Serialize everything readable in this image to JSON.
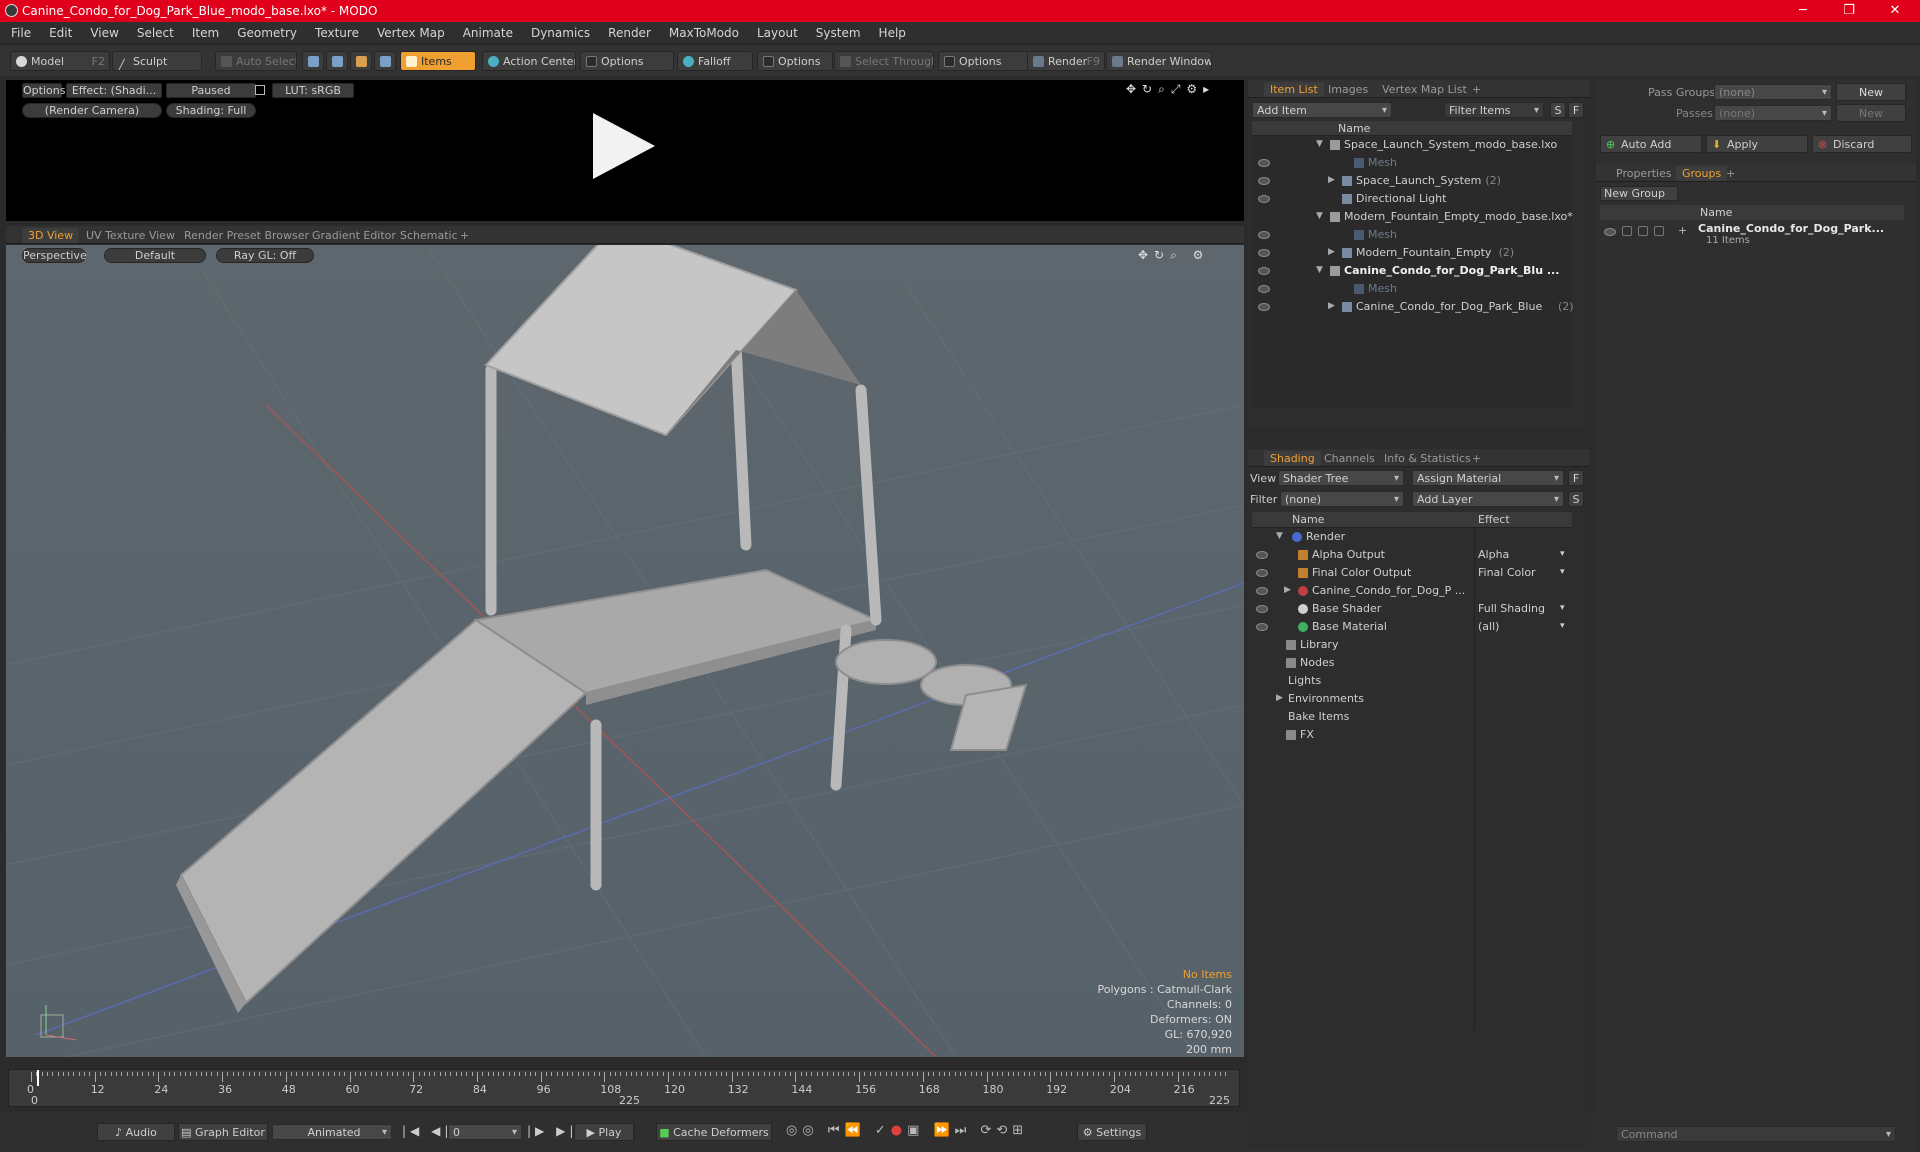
{
  "window": {
    "title": "Canine_Condo_for_Dog_Park_Blue_modo_base.lxo* - MODO",
    "min": "─",
    "max": "❐",
    "close": "✕"
  },
  "menu": [
    "File",
    "Edit",
    "View",
    "Select",
    "Item",
    "Geometry",
    "Texture",
    "Vertex Map",
    "Animate",
    "Dynamics",
    "Render",
    "MaxToModo",
    "Layout",
    "System",
    "Help"
  ],
  "toolbar": {
    "model": "Model",
    "model_key": "F2",
    "sculpt": "Sculpt",
    "auto_select": "Auto Select",
    "items": "Items",
    "action_center": "Action Center",
    "options1": "Options",
    "falloff": "Falloff",
    "options2": "Options",
    "select_through": "Select Through",
    "options3": "Options",
    "render": "Render",
    "render_key": "F9",
    "render_window": "Render Window"
  },
  "preview": {
    "options": "Options",
    "effect": "Effect: (Shadi...",
    "paused": "Paused",
    "lut": "LUT: sRGB",
    "camera": "(Render Camera)",
    "shading": "Shading: Full"
  },
  "viewport_tabs": [
    "3D View",
    "UV Texture View",
    "Render Preset Browser",
    "Gradient Editor",
    "Schematic",
    "+"
  ],
  "viewport": {
    "perspective": "Perspective",
    "default": "Default",
    "raygl": "Ray GL: Off",
    "info": {
      "no_items": "No Items",
      "polygons": "Polygons : Catmull-Clark",
      "channels": "Channels: 0",
      "deformers": "Deformers: ON",
      "gl": "GL: 670,920",
      "size": "200 mm"
    }
  },
  "timeline": {
    "ticks": [
      "0",
      "12",
      "24",
      "36",
      "48",
      "60",
      "72",
      "84",
      "96",
      "108",
      "120",
      "132",
      "144",
      "156",
      "168",
      "180",
      "192",
      "204",
      "216"
    ],
    "start": "0",
    "mid": "225",
    "end": "225"
  },
  "bottom": {
    "audio": "Audio",
    "graph_editor": "Graph Editor",
    "animated": "Animated",
    "frame": "0",
    "play": "Play",
    "cache": "Cache Deformers",
    "settings": "Settings"
  },
  "itemlist": {
    "tabs": [
      "Item List",
      "Images",
      "Vertex Map List",
      "+"
    ],
    "add_item": "Add Item",
    "filter": "Filter Items",
    "s": "S",
    "f": "F",
    "col_name": "Name",
    "rows": [
      {
        "label": "Space_Launch_System_modo_base.lxo",
        "indent": 0,
        "arrow": "▼",
        "eye": false,
        "dim": false,
        "bold": false,
        "count": ""
      },
      {
        "label": "Mesh",
        "indent": 2,
        "arrow": "",
        "eye": true,
        "dim": true,
        "bold": false,
        "count": ""
      },
      {
        "label": "Space_Launch_System",
        "indent": 1,
        "arrow": "▶",
        "eye": true,
        "dim": false,
        "bold": false,
        "count": "(2)"
      },
      {
        "label": "Directional Light",
        "indent": 1,
        "arrow": "",
        "eye": true,
        "dim": false,
        "bold": false,
        "count": ""
      },
      {
        "label": "Modern_Fountain_Empty_modo_base.lxo*",
        "indent": 0,
        "arrow": "▼",
        "eye": false,
        "dim": false,
        "bold": false,
        "count": ""
      },
      {
        "label": "Mesh",
        "indent": 2,
        "arrow": "",
        "eye": true,
        "dim": true,
        "bold": false,
        "count": ""
      },
      {
        "label": "Modern_Fountain_Empty",
        "indent": 1,
        "arrow": "▶",
        "eye": true,
        "dim": false,
        "bold": false,
        "count": "(2)"
      },
      {
        "label": "Canine_Condo_for_Dog_Park_Blu ...",
        "indent": 0,
        "arrow": "▼",
        "eye": true,
        "dim": false,
        "bold": true,
        "count": ""
      },
      {
        "label": "Mesh",
        "indent": 2,
        "arrow": "",
        "eye": true,
        "dim": true,
        "bold": false,
        "count": ""
      },
      {
        "label": "Canine_Condo_for_Dog_Park_Blue",
        "indent": 1,
        "arrow": "▶",
        "eye": true,
        "dim": false,
        "bold": false,
        "count": "(2)"
      }
    ]
  },
  "shading": {
    "tabs": [
      "Shading",
      "Channels",
      "Info & Statistics",
      "+"
    ],
    "view_label": "View",
    "view_value": "Shader Tree",
    "assign": "Assign Material",
    "filter_label": "Filter",
    "filter_value": "(none)",
    "add_layer": "Add Layer",
    "f": "F",
    "s": "S",
    "col_name": "Name",
    "col_effect": "Effect",
    "rows": [
      {
        "label": "Render",
        "effect": "",
        "indent": 0,
        "arrow": "▼",
        "eye": false,
        "icon": "sphere-blue"
      },
      {
        "label": "Alpha Output",
        "effect": "Alpha",
        "indent": 1,
        "arrow": "",
        "eye": true,
        "icon": "output"
      },
      {
        "label": "Final Color Output",
        "effect": "Final Color",
        "indent": 1,
        "arrow": "",
        "eye": true,
        "icon": "output"
      },
      {
        "label": "Canine_Condo_for_Dog_P ...",
        "effect": "",
        "indent": 1,
        "arrow": "▶",
        "eye": true,
        "icon": "material-red"
      },
      {
        "label": "Base Shader",
        "effect": "Full Shading",
        "indent": 1,
        "arrow": "",
        "eye": true,
        "icon": "shader"
      },
      {
        "label": "Base Material",
        "effect": "(all)",
        "indent": 1,
        "arrow": "",
        "eye": true,
        "icon": "material-green"
      },
      {
        "label": "Library",
        "effect": "",
        "indent": 0,
        "arrow": "",
        "eye": false,
        "icon": "folder"
      },
      {
        "label": "Nodes",
        "effect": "",
        "indent": 0,
        "arrow": "",
        "eye": false,
        "icon": "folder"
      },
      {
        "label": "Lights",
        "effect": "",
        "indent": 0,
        "arrow": "",
        "eye": false,
        "icon": ""
      },
      {
        "label": "Environments",
        "effect": "",
        "indent": 0,
        "arrow": "▶",
        "eye": false,
        "icon": ""
      },
      {
        "label": "Bake Items",
        "effect": "",
        "indent": 0,
        "arrow": "",
        "eye": false,
        "icon": ""
      },
      {
        "label": "FX",
        "effect": "",
        "indent": 0,
        "arrow": "",
        "eye": false,
        "icon": "fx"
      }
    ]
  },
  "groups": {
    "pass_groups": "Pass Groups",
    "passes": "Passes",
    "none1": "(none)",
    "none2": "(none)",
    "new1": "New",
    "new2": "New",
    "auto_add": "Auto Add",
    "apply": "Apply",
    "discard": "Discard",
    "tabs": [
      "Properties",
      "Groups",
      "+"
    ],
    "new_group": "New Group",
    "col_name": "Name",
    "item_name": "Canine_Condo_for_Dog_Park...",
    "item_count": "11 Items"
  },
  "command": {
    "placeholder": "Command"
  },
  "colors": {
    "accent": "#f0a030",
    "title_red": "#e0001b"
  }
}
